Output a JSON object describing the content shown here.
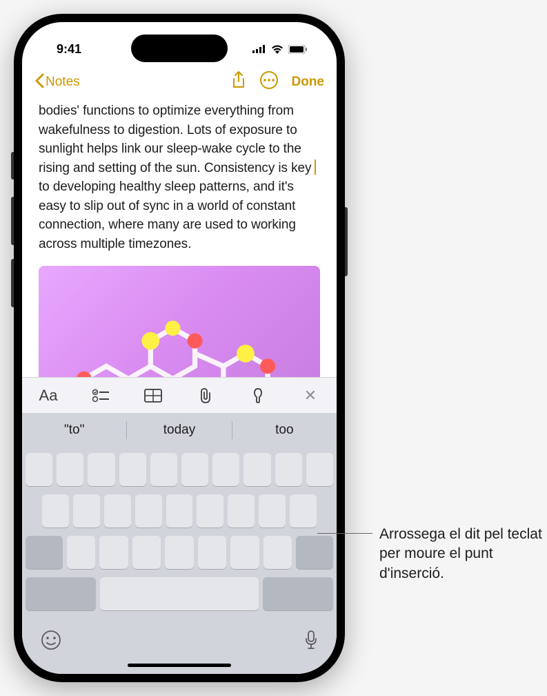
{
  "status": {
    "time": "9:41"
  },
  "nav": {
    "back_label": "Notes",
    "done_label": "Done"
  },
  "note": {
    "text_before_cursor": "bodies' functions to optimize everything from wakefulness to digestion. Lots of exposure to sunlight helps link our sleep-wake cycle to the rising and setting of the sun. Consistency is key ",
    "text_after_cursor": "to developing healthy sleep patterns, and it's easy to slip out of sync in a world of constant connection, where many are used to working across multiple timezones."
  },
  "suggestions": {
    "items": [
      "\"to\"",
      "today",
      "too"
    ]
  },
  "icons": {
    "format_text": "Aa",
    "close": "✕"
  },
  "callout": {
    "text": "Arrossega el dit pel teclat per moure el punt d'inserció."
  }
}
